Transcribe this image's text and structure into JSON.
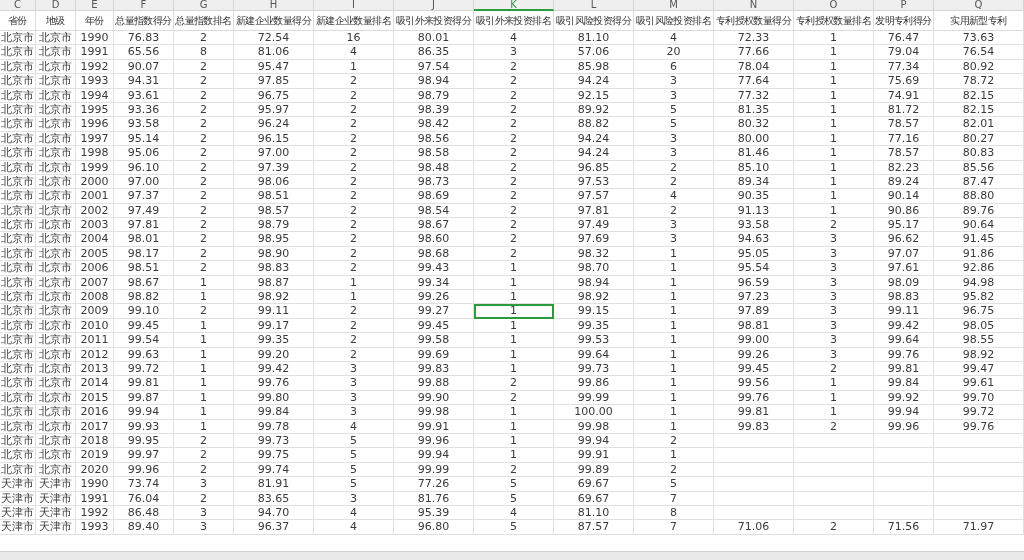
{
  "columns": [
    {
      "letter": "C",
      "header": "省份",
      "selected": false
    },
    {
      "letter": "D",
      "header": "地级",
      "selected": false
    },
    {
      "letter": "E",
      "header": "年份",
      "selected": false
    },
    {
      "letter": "F",
      "header": "总量指数得分",
      "selected": false
    },
    {
      "letter": "G",
      "header": "总量指数排名",
      "selected": false
    },
    {
      "letter": "H",
      "header": "新建企业数量得分",
      "selected": false
    },
    {
      "letter": "I",
      "header": "新建企业数量排名",
      "selected": false
    },
    {
      "letter": "J",
      "header": "吸引外来投资得分",
      "selected": false
    },
    {
      "letter": "K",
      "header": "吸引外来投资排名",
      "selected": true
    },
    {
      "letter": "L",
      "header": "吸引风险投资得分",
      "selected": false
    },
    {
      "letter": "M",
      "header": "吸引风险投资排名",
      "selected": false
    },
    {
      "letter": "N",
      "header": "专利授权数量得分",
      "selected": false
    },
    {
      "letter": "O",
      "header": "专利授权数量排名",
      "selected": false
    },
    {
      "letter": "P",
      "header": "发明专利得分",
      "selected": false
    },
    {
      "letter": "Q",
      "header": "实用新型专利",
      "selected": false
    }
  ],
  "rows": [
    {
      "selected": false,
      "cells": [
        "北京市",
        "北京市",
        "1990",
        "76.83",
        "2",
        "72.54",
        "16",
        "80.01",
        "4",
        "81.10",
        "4",
        "72.33",
        "1",
        "76.47",
        "73.63"
      ]
    },
    {
      "selected": false,
      "cells": [
        "北京市",
        "北京市",
        "1991",
        "65.56",
        "8",
        "81.06",
        "4",
        "86.35",
        "3",
        "57.06",
        "20",
        "77.66",
        "1",
        "79.04",
        "76.54"
      ]
    },
    {
      "selected": false,
      "cells": [
        "北京市",
        "北京市",
        "1992",
        "90.07",
        "2",
        "95.47",
        "1",
        "97.54",
        "2",
        "85.98",
        "6",
        "78.04",
        "1",
        "77.34",
        "80.92"
      ]
    },
    {
      "selected": false,
      "cells": [
        "北京市",
        "北京市",
        "1993",
        "94.31",
        "2",
        "97.85",
        "2",
        "98.94",
        "2",
        "94.24",
        "3",
        "77.64",
        "1",
        "75.69",
        "78.72"
      ]
    },
    {
      "selected": false,
      "cells": [
        "北京市",
        "北京市",
        "1994",
        "93.61",
        "2",
        "96.75",
        "2",
        "98.79",
        "2",
        "92.15",
        "3",
        "77.32",
        "1",
        "74.91",
        "82.15"
      ]
    },
    {
      "selected": false,
      "cells": [
        "北京市",
        "北京市",
        "1995",
        "93.36",
        "2",
        "95.97",
        "2",
        "98.39",
        "2",
        "89.92",
        "5",
        "81.35",
        "1",
        "81.72",
        "82.15"
      ]
    },
    {
      "selected": false,
      "cells": [
        "北京市",
        "北京市",
        "1996",
        "93.58",
        "2",
        "96.24",
        "2",
        "98.42",
        "2",
        "88.82",
        "5",
        "80.32",
        "1",
        "78.57",
        "82.01"
      ]
    },
    {
      "selected": false,
      "cells": [
        "北京市",
        "北京市",
        "1997",
        "95.14",
        "2",
        "96.15",
        "2",
        "98.56",
        "2",
        "94.24",
        "3",
        "80.00",
        "1",
        "77.16",
        "80.27"
      ]
    },
    {
      "selected": false,
      "cells": [
        "北京市",
        "北京市",
        "1998",
        "95.06",
        "2",
        "97.00",
        "2",
        "98.58",
        "2",
        "94.24",
        "3",
        "81.46",
        "1",
        "78.57",
        "80.83"
      ]
    },
    {
      "selected": false,
      "cells": [
        "北京市",
        "北京市",
        "1999",
        "96.10",
        "2",
        "97.39",
        "2",
        "98.48",
        "2",
        "96.85",
        "2",
        "85.10",
        "1",
        "82.23",
        "85.56"
      ]
    },
    {
      "selected": false,
      "cells": [
        "北京市",
        "北京市",
        "2000",
        "97.00",
        "2",
        "98.06",
        "2",
        "98.73",
        "2",
        "97.53",
        "2",
        "89.34",
        "1",
        "89.24",
        "87.47"
      ]
    },
    {
      "selected": false,
      "cells": [
        "北京市",
        "北京市",
        "2001",
        "97.37",
        "2",
        "98.51",
        "2",
        "98.69",
        "2",
        "97.57",
        "4",
        "90.35",
        "1",
        "90.14",
        "88.80"
      ]
    },
    {
      "selected": false,
      "cells": [
        "北京市",
        "北京市",
        "2002",
        "97.49",
        "2",
        "98.57",
        "2",
        "98.54",
        "2",
        "97.81",
        "2",
        "91.13",
        "1",
        "90.86",
        "89.76"
      ]
    },
    {
      "selected": false,
      "cells": [
        "北京市",
        "北京市",
        "2003",
        "97.81",
        "2",
        "98.79",
        "2",
        "98.67",
        "2",
        "97.49",
        "3",
        "93.58",
        "2",
        "95.17",
        "90.64"
      ]
    },
    {
      "selected": false,
      "cells": [
        "北京市",
        "北京市",
        "2004",
        "98.01",
        "2",
        "98.95",
        "2",
        "98.60",
        "2",
        "97.69",
        "3",
        "94.63",
        "3",
        "96.62",
        "91.45"
      ]
    },
    {
      "selected": false,
      "cells": [
        "北京市",
        "北京市",
        "2005",
        "98.17",
        "2",
        "98.90",
        "2",
        "98.68",
        "2",
        "98.32",
        "1",
        "95.05",
        "3",
        "97.07",
        "91.86"
      ]
    },
    {
      "selected": false,
      "cells": [
        "北京市",
        "北京市",
        "2006",
        "98.51",
        "2",
        "98.83",
        "2",
        "99.43",
        "1",
        "98.70",
        "1",
        "95.54",
        "3",
        "97.61",
        "92.86"
      ]
    },
    {
      "selected": false,
      "cells": [
        "北京市",
        "北京市",
        "2007",
        "98.67",
        "1",
        "98.87",
        "1",
        "99.34",
        "1",
        "98.94",
        "1",
        "96.59",
        "3",
        "98.09",
        "94.98"
      ]
    },
    {
      "selected": false,
      "cells": [
        "北京市",
        "北京市",
        "2008",
        "98.82",
        "1",
        "98.92",
        "1",
        "99.26",
        "1",
        "98.92",
        "1",
        "97.23",
        "3",
        "98.83",
        "95.82"
      ]
    },
    {
      "selected": true,
      "cells": [
        "北京市",
        "北京市",
        "2009",
        "99.10",
        "2",
        "99.11",
        "2",
        "99.27",
        "1",
        "99.15",
        "1",
        "97.89",
        "3",
        "99.11",
        "96.75"
      ]
    },
    {
      "selected": false,
      "cells": [
        "北京市",
        "北京市",
        "2010",
        "99.45",
        "1",
        "99.17",
        "2",
        "99.45",
        "1",
        "99.35",
        "1",
        "98.81",
        "3",
        "99.42",
        "98.05"
      ]
    },
    {
      "selected": false,
      "cells": [
        "北京市",
        "北京市",
        "2011",
        "99.54",
        "1",
        "99.35",
        "2",
        "99.58",
        "1",
        "99.53",
        "1",
        "99.00",
        "3",
        "99.64",
        "98.55"
      ]
    },
    {
      "selected": false,
      "cells": [
        "北京市",
        "北京市",
        "2012",
        "99.63",
        "1",
        "99.20",
        "2",
        "99.69",
        "1",
        "99.64",
        "1",
        "99.26",
        "3",
        "99.76",
        "98.92"
      ]
    },
    {
      "selected": false,
      "cells": [
        "北京市",
        "北京市",
        "2013",
        "99.72",
        "1",
        "99.42",
        "3",
        "99.83",
        "1",
        "99.73",
        "1",
        "99.45",
        "2",
        "99.81",
        "99.47"
      ]
    },
    {
      "selected": false,
      "cells": [
        "北京市",
        "北京市",
        "2014",
        "99.81",
        "1",
        "99.76",
        "3",
        "99.88",
        "2",
        "99.86",
        "1",
        "99.56",
        "1",
        "99.84",
        "99.61"
      ]
    },
    {
      "selected": false,
      "cells": [
        "北京市",
        "北京市",
        "2015",
        "99.87",
        "1",
        "99.80",
        "3",
        "99.90",
        "2",
        "99.99",
        "1",
        "99.76",
        "1",
        "99.92",
        "99.70"
      ]
    },
    {
      "selected": false,
      "cells": [
        "北京市",
        "北京市",
        "2016",
        "99.94",
        "1",
        "99.84",
        "3",
        "99.98",
        "1",
        "100.00",
        "1",
        "99.81",
        "1",
        "99.94",
        "99.72"
      ]
    },
    {
      "selected": false,
      "cells": [
        "北京市",
        "北京市",
        "2017",
        "99.93",
        "1",
        "99.78",
        "4",
        "99.91",
        "1",
        "99.98",
        "1",
        "99.83",
        "2",
        "99.96",
        "99.76"
      ]
    },
    {
      "selected": false,
      "cells": [
        "北京市",
        "北京市",
        "2018",
        "99.95",
        "2",
        "99.73",
        "5",
        "99.96",
        "1",
        "99.94",
        "2",
        null,
        null,
        null,
        null
      ]
    },
    {
      "selected": false,
      "cells": [
        "北京市",
        "北京市",
        "2019",
        "99.97",
        "2",
        "99.75",
        "5",
        "99.94",
        "1",
        "99.91",
        "1",
        null,
        null,
        null,
        null
      ]
    },
    {
      "selected": false,
      "cells": [
        "北京市",
        "北京市",
        "2020",
        "99.96",
        "2",
        "99.74",
        "5",
        "99.99",
        "2",
        "99.89",
        "2",
        null,
        null,
        null,
        null
      ]
    },
    {
      "selected": false,
      "cells": [
        "天津市",
        "天津市",
        "1990",
        "73.74",
        "3",
        "81.91",
        "5",
        "77.26",
        "5",
        "69.67",
        "5",
        null,
        null,
        null,
        null
      ]
    },
    {
      "selected": false,
      "cells": [
        "天津市",
        "天津市",
        "1991",
        "76.04",
        "2",
        "83.65",
        "3",
        "81.76",
        "5",
        "69.67",
        "7",
        null,
        null,
        null,
        null
      ]
    },
    {
      "selected": false,
      "cells": [
        "天津市",
        "天津市",
        "1992",
        "86.48",
        "3",
        "94.70",
        "4",
        "95.39",
        "4",
        "81.10",
        "8",
        null,
        null,
        null,
        null
      ]
    },
    {
      "selected": false,
      "cells": [
        "天津市",
        "天津市",
        "1993",
        "89.40",
        "3",
        "96.37",
        "4",
        "96.80",
        "5",
        "87.57",
        "7",
        "71.06",
        "2",
        "71.56",
        "71.97"
      ]
    }
  ]
}
